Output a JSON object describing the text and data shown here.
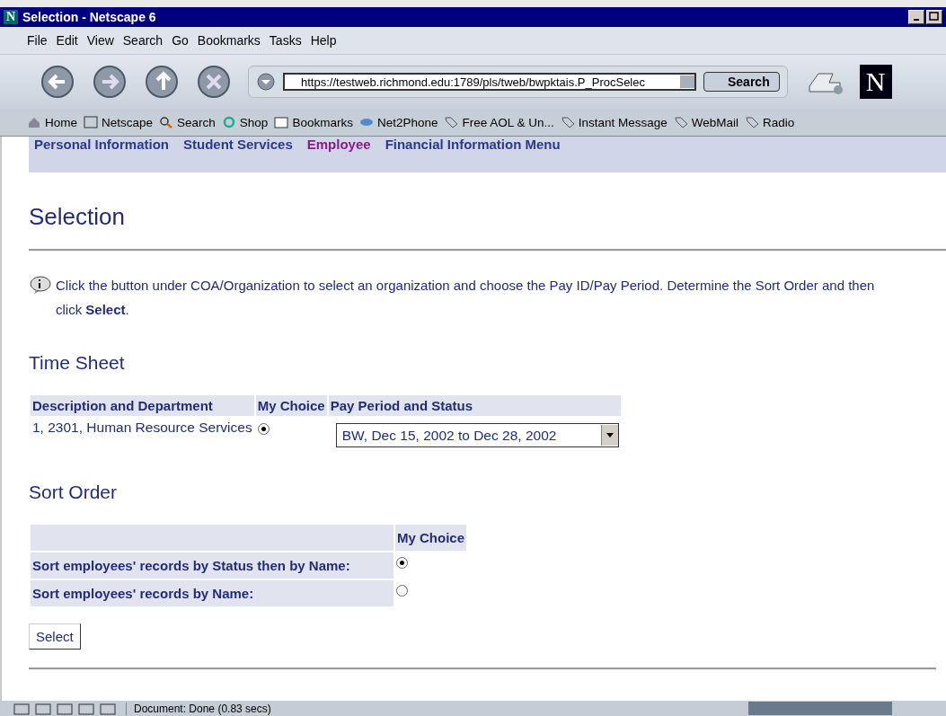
{
  "window": {
    "title": "Selection - Netscape 6",
    "logo": "N"
  },
  "menu": [
    "File",
    "Edit",
    "View",
    "Search",
    "Go",
    "Bookmarks",
    "Tasks",
    "Help"
  ],
  "navigation": {
    "url": "https://testweb.richmond.edu:1789/pls/tweb/bwpktais.P_ProcSelec",
    "search_button": "Search",
    "logo": "N"
  },
  "personal_toolbar": [
    {
      "label": "Home",
      "kind": "home"
    },
    {
      "label": "Netscape",
      "kind": "my"
    },
    {
      "label": "Search",
      "kind": "search"
    },
    {
      "label": "Shop",
      "kind": "shop"
    },
    {
      "label": "Bookmarks",
      "kind": "folder"
    },
    {
      "label": "Net2Phone",
      "kind": "phone"
    },
    {
      "label": "Free AOL & Un...",
      "kind": "tag"
    },
    {
      "label": "Instant Message",
      "kind": "tag"
    },
    {
      "label": "WebMail",
      "kind": "tag"
    },
    {
      "label": "Radio",
      "kind": "tag"
    }
  ],
  "site_nav": [
    {
      "label": "Personal Information",
      "selected": false
    },
    {
      "label": "Student Services",
      "selected": false
    },
    {
      "label": "Employee",
      "selected": true
    },
    {
      "label": "Financial Information Menu",
      "selected": false
    }
  ],
  "page_title": "Selection",
  "info": "Click the button under COA/Organization to select an organization and choose the Pay ID/Pay Period. Determine the Sort Order and then click **Select**.",
  "time_sheet": {
    "title": "Time Sheet",
    "columns": [
      "Description and Department",
      "My Choice",
      "Pay Period and Status"
    ],
    "rows": [
      {
        "description": "1, 2301, Human Resource Services",
        "selected": true,
        "pay_period": "BW, Dec 15, 2002 to Dec 28, 2002"
      }
    ]
  },
  "sort_order": {
    "title": "Sort Order",
    "column": "My Choice",
    "options": [
      {
        "label": "Sort employees' records by Status then by Name:",
        "selected": true
      },
      {
        "label": "Sort employees' records by Name:",
        "selected": false
      }
    ]
  },
  "submit_button": "Select",
  "status_bar": "Document: Done (0.83 secs)"
}
